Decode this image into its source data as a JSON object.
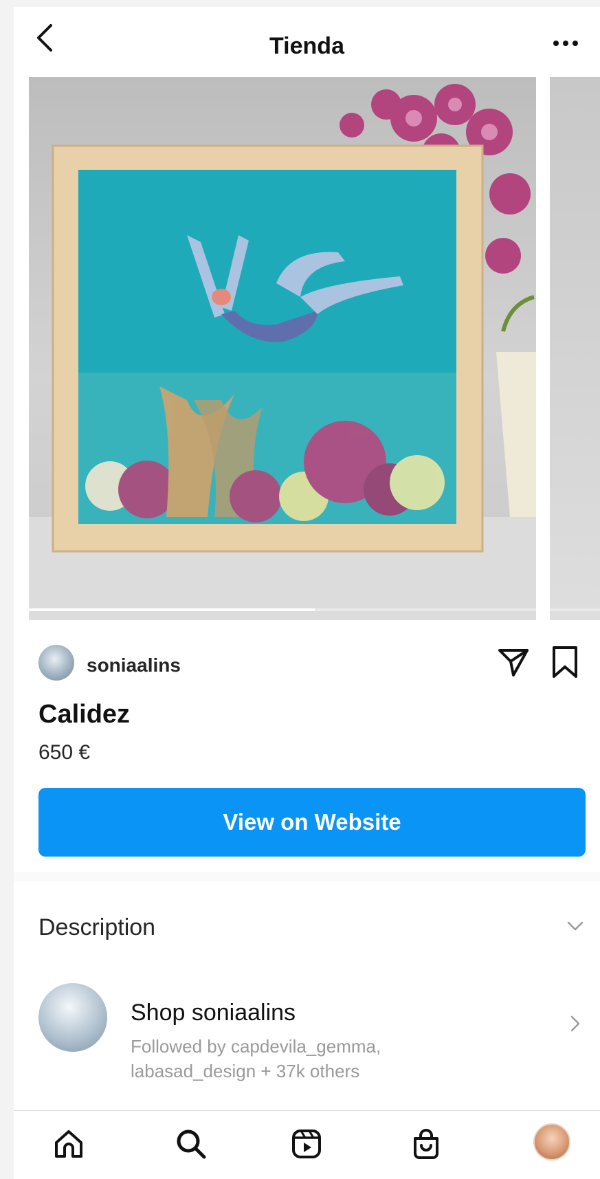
{
  "header": {
    "title": "Tienda",
    "back_icon": "chevron-left-icon",
    "more_icon": "more-horizontal-icon",
    "more_label": "•••"
  },
  "carousel": {
    "progress_fraction": 0.5,
    "slide_count_visible": 2
  },
  "product": {
    "seller": "soniaalins",
    "title": "Calidez",
    "price": "650 €",
    "share_icon": "send-icon",
    "save_icon": "bookmark-icon"
  },
  "cta": {
    "label": "View on Website",
    "color": "#0a95f6"
  },
  "description": {
    "label": "Description",
    "chevron_icon": "chevron-down-icon"
  },
  "shop": {
    "name": "Shop soniaalins",
    "followed_line1": "Followed by capdevila_gemma,",
    "followed_line2": "labasad_design + 37k others",
    "chevron_icon": "chevron-right-icon"
  },
  "tabbar": {
    "items": [
      {
        "icon": "home-icon"
      },
      {
        "icon": "search-icon"
      },
      {
        "icon": "reels-icon"
      },
      {
        "icon": "shop-icon"
      },
      {
        "icon": "profile-avatar"
      }
    ]
  }
}
